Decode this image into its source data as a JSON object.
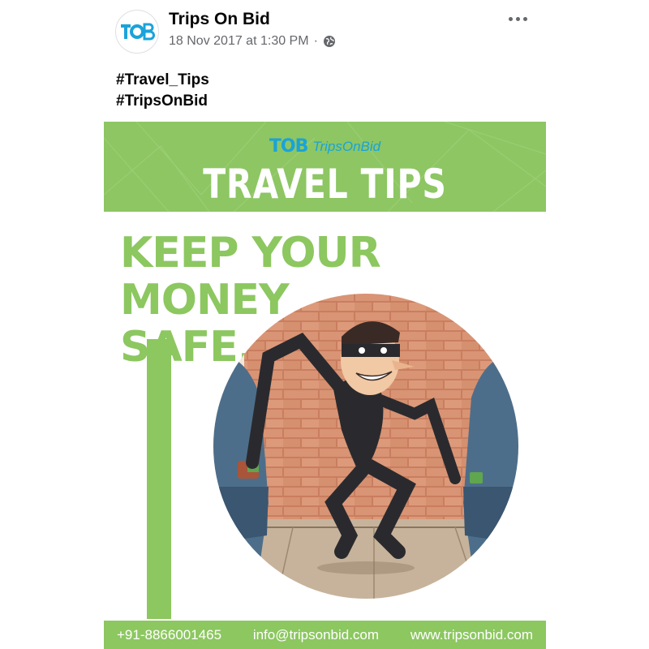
{
  "post": {
    "page_name": "Trips On Bid",
    "timestamp": "18 Nov 2017 at 1:30 PM",
    "separator": "·",
    "privacy_icon": "globe-icon",
    "more_icon": "more-horizontal-icon",
    "avatar_logo": "TOB",
    "hashtags": [
      "#Travel_Tips",
      "#TripsOnBid"
    ]
  },
  "image": {
    "brand_logo": "TOB",
    "brand_name": "TripsOnBid",
    "banner_title": "TRAVEL TIPS",
    "headline_line1": "KEEP YOUR MONEY",
    "headline_line2": "SAFE.",
    "illustration": "pickpocket-thief-illustration",
    "footer": {
      "phone": "+91-8866001465",
      "email": "info@tripsonbid.com",
      "website": "www.tripsonbid.com"
    },
    "colors": {
      "green": "#8cc760",
      "brand_blue": "#1aa3d9",
      "brick": "#d38a6a"
    }
  }
}
